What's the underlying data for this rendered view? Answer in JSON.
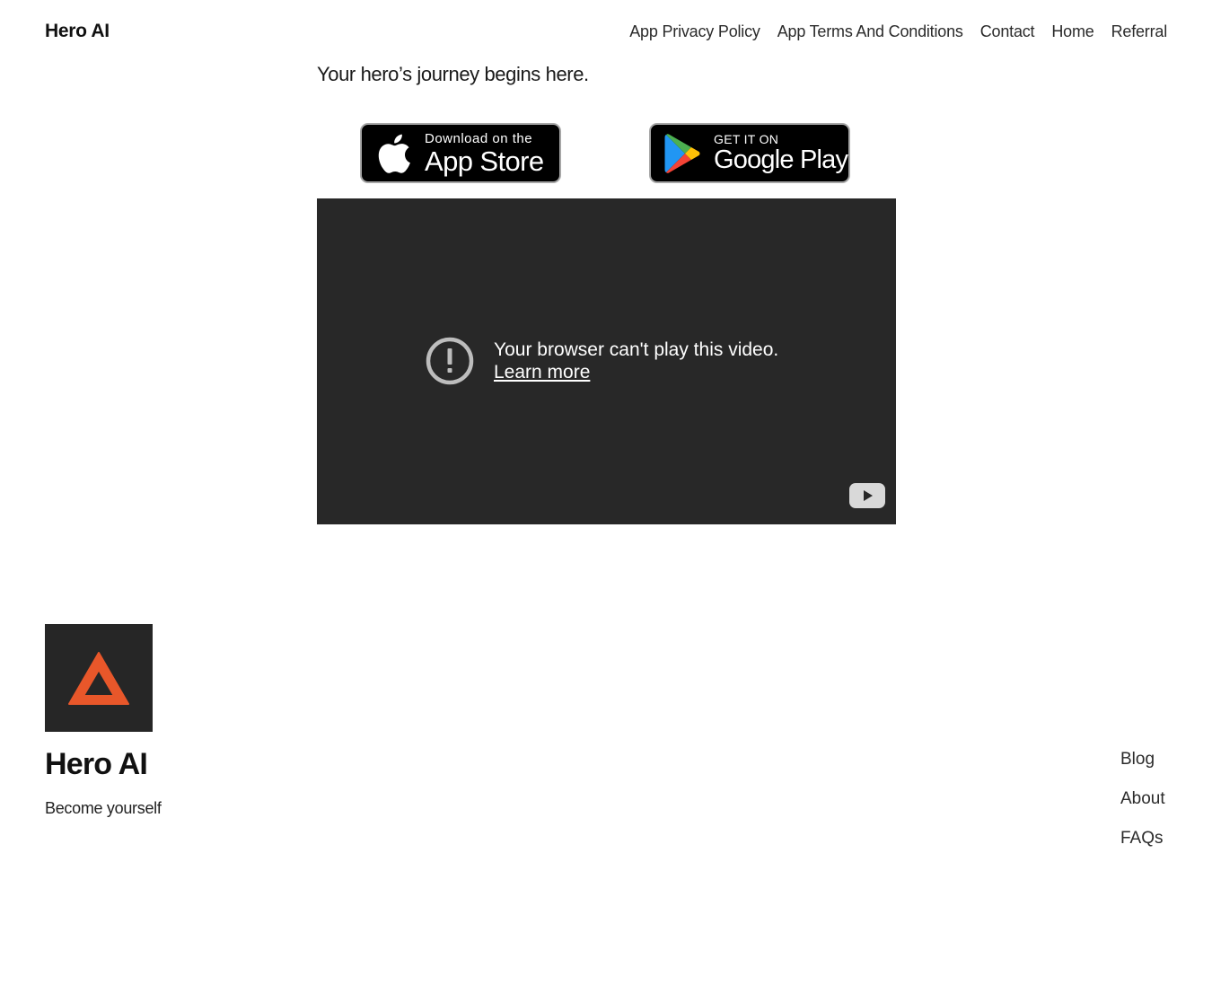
{
  "header": {
    "site_title": "Hero AI",
    "nav": [
      {
        "label": "App Privacy Policy"
      },
      {
        "label": "App Terms And Conditions"
      },
      {
        "label": "Contact"
      },
      {
        "label": "Home"
      },
      {
        "label": "Referral"
      }
    ]
  },
  "main": {
    "tagline": "Your hero’s journey begins here.",
    "badges": {
      "apple": {
        "small": "Download on the",
        "big": "App Store",
        "icon": "apple-icon"
      },
      "google": {
        "small": "GET IT ON",
        "big": "Google Play",
        "icon": "google-play-icon"
      }
    },
    "video": {
      "error_message": "Your browser can't play this video.",
      "learn_more": "Learn more",
      "background": "#282828",
      "icons": [
        "exclamation-circle-icon",
        "youtube-icon"
      ]
    }
  },
  "footer": {
    "logo_icon": "triangle-logo-icon",
    "logo_color": "#e8572a",
    "title": "Hero AI",
    "tagline": "Become yourself",
    "nav": [
      {
        "label": "Blog"
      },
      {
        "label": "About"
      },
      {
        "label": "FAQs"
      }
    ]
  }
}
